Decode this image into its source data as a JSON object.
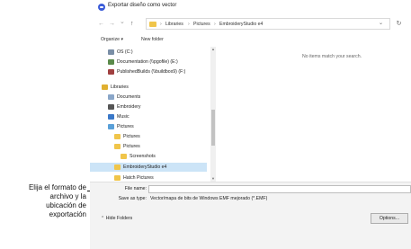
{
  "window": {
    "title": "Exportar diseño como vector"
  },
  "nav": {
    "back_glyph": "←",
    "forward_glyph": "→",
    "recent_glyph": "⌄",
    "up_glyph": "↑",
    "breadcrumbs": [
      "Libraries",
      "Pictures",
      "EmbroideryStudio e4"
    ],
    "separator": "›",
    "dropdown_glyph": "⌄",
    "refresh_glyph": "↻"
  },
  "toolbar": {
    "organize_label": "Organize ▾",
    "new_folder_label": "New folder"
  },
  "sidebar": {
    "items": [
      {
        "label": "OS (C:)",
        "icon": "drive-icon",
        "color": "#7a8ea6"
      },
      {
        "label": "Documentation (\\\\pgofile) (E:)",
        "icon": "network-drive-icon",
        "color": "#5a8a4a"
      },
      {
        "label": "PublishedBuilds (\\\\buildbox9) (F:)",
        "icon": "network-drive-icon",
        "color": "#a04040"
      },
      {
        "label": "Libraries",
        "icon": "libraries-icon",
        "color": "#e0b030"
      },
      {
        "label": "Documents",
        "icon": "documents-icon",
        "color": "#8aa6c8"
      },
      {
        "label": "Embroidery",
        "icon": "library-icon",
        "color": "#555555"
      },
      {
        "label": "Music",
        "icon": "music-icon",
        "color": "#3a78c8"
      },
      {
        "label": "Pictures",
        "icon": "pictures-icon",
        "color": "#5aa0d8"
      },
      {
        "label": "Pictures",
        "icon": "folder-icon",
        "color": "#f0c54a"
      },
      {
        "label": "Pictures",
        "icon": "folder-icon",
        "color": "#f0c54a"
      },
      {
        "label": "Screenshots",
        "icon": "folder-icon",
        "color": "#f0c54a"
      },
      {
        "label": "EmbroideryStudio e4",
        "icon": "folder-icon",
        "color": "#f0c54a"
      },
      {
        "label": "Hatch Pictures",
        "icon": "folder-icon",
        "color": "#f0c54a"
      }
    ]
  },
  "main": {
    "empty_message": "No items match your search."
  },
  "bottom": {
    "filename_label": "File name:",
    "filename_value": "",
    "savetype_label": "Save as type:",
    "savetype_value": "Vector/mapa de bits de Windows EMF mejorado (*.EMF)",
    "hide_folders_label": "⌃ Hide Folders",
    "options_label": "Options..."
  },
  "callout": {
    "line1": "Elija el formato de",
    "line2": "archivo y la",
    "line3": "ubicación de",
    "line4": "exportación"
  }
}
